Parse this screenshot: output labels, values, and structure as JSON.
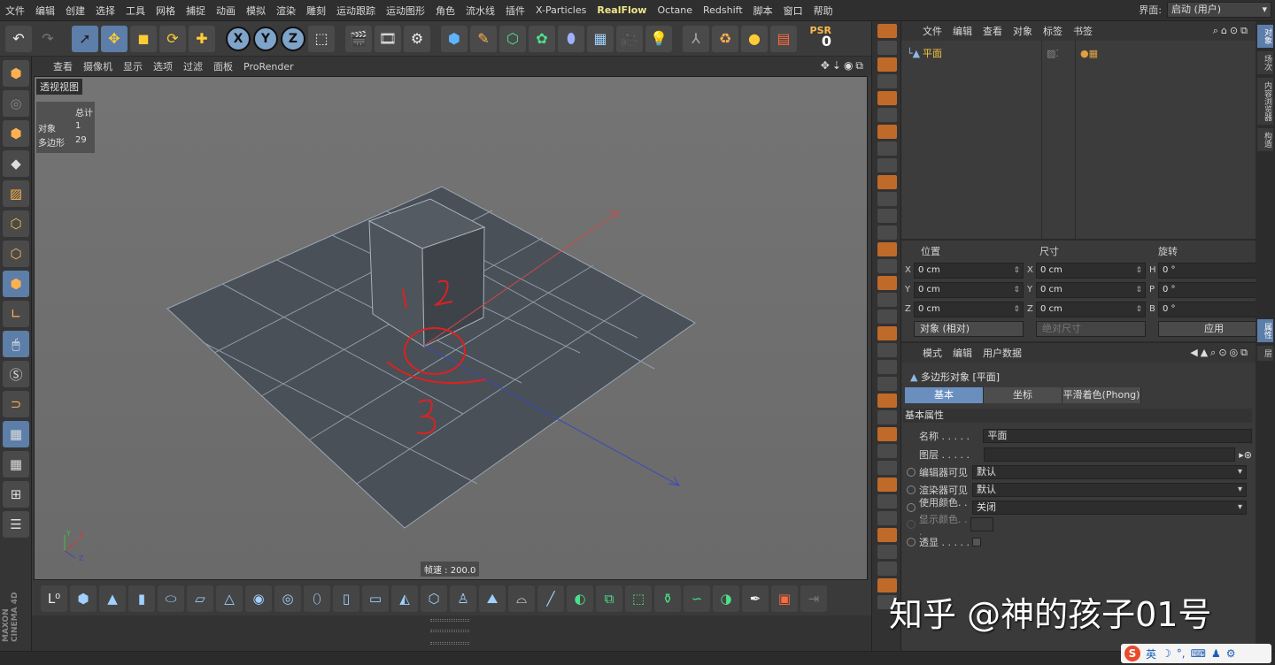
{
  "menu": [
    "文件",
    "编辑",
    "创建",
    "选择",
    "工具",
    "网格",
    "捕捉",
    "动画",
    "模拟",
    "渲染",
    "雕刻",
    "运动跟踪",
    "运动图形",
    "角色",
    "流水线",
    "插件",
    "X-Particles",
    "RealFlow",
    "Octane",
    "Redshift",
    "脚本",
    "窗口",
    "帮助"
  ],
  "highlighted_menu": "RealFlow",
  "interface": {
    "label": "界面:",
    "value": "启动 (用户)"
  },
  "psr": {
    "label": "PSR",
    "value": "0"
  },
  "viewport_menu": [
    "查看",
    "摄像机",
    "显示",
    "选项",
    "过滤",
    "面板",
    "ProRender"
  ],
  "viewport": {
    "title": "透视视图",
    "hud": {
      "header": "总计",
      "rows": [
        {
          "k": "对象",
          "v": "1"
        },
        {
          "k": "多边形",
          "v": "29"
        }
      ]
    },
    "fps": "帧速 : 200.0",
    "annotations": [
      "1",
      "2",
      "3"
    ],
    "axis_labels": {
      "y": "Y",
      "x": "X",
      "z": "Z"
    }
  },
  "objmgr": {
    "menu": [
      "文件",
      "编辑",
      "查看",
      "对象",
      "标签",
      "书签"
    ],
    "object_name": "平面"
  },
  "coords": {
    "headers": [
      "位置",
      "尺寸",
      "旋转"
    ],
    "pos": [
      {
        "axis": "X",
        "value": "0 cm"
      },
      {
        "axis": "Y",
        "value": "0 cm"
      },
      {
        "axis": "Z",
        "value": "0 cm"
      }
    ],
    "size": [
      {
        "axis": "X",
        "value": "0 cm"
      },
      {
        "axis": "Y",
        "value": "0 cm"
      },
      {
        "axis": "Z",
        "value": "0 cm"
      }
    ],
    "rot": [
      {
        "axis": "H",
        "value": "0 °"
      },
      {
        "axis": "P",
        "value": "0 °"
      },
      {
        "axis": "B",
        "value": "0 °"
      }
    ],
    "mode": "对象 (相对)",
    "size_mode": "绝对尺寸",
    "apply": "应用"
  },
  "attr": {
    "menu": [
      "模式",
      "编辑",
      "用户数据"
    ],
    "object_label": "多边形对象 [平面]",
    "tabs": [
      "基本",
      "坐标",
      "平滑着色(Phong)"
    ],
    "section": "基本属性",
    "rows": [
      {
        "label": "名称 . . . . .",
        "value": "平面"
      },
      {
        "label": "图层 . . . . .",
        "value": ""
      },
      {
        "label": "编辑器可见",
        "value": "默认"
      },
      {
        "label": "渲染器可见",
        "value": "默认"
      },
      {
        "label": "使用颜色. . .",
        "value": "关闭"
      },
      {
        "label": "显示颜色. . .",
        "value": ""
      },
      {
        "label": "透显 . . . . .",
        "value": ""
      }
    ]
  },
  "sidetabs": [
    "对象",
    "场次",
    "内容浏览器",
    "构造",
    "属性",
    "层"
  ],
  "brand": "MAXON CINEMA 4D",
  "watermark": "知乎 @神的孩子01号",
  "ime": {
    "badge": "S",
    "text": "英"
  },
  "colors": {
    "accent": "#6a8fbf",
    "object_highlight": "#f5c542",
    "annotation": "#e02020"
  }
}
